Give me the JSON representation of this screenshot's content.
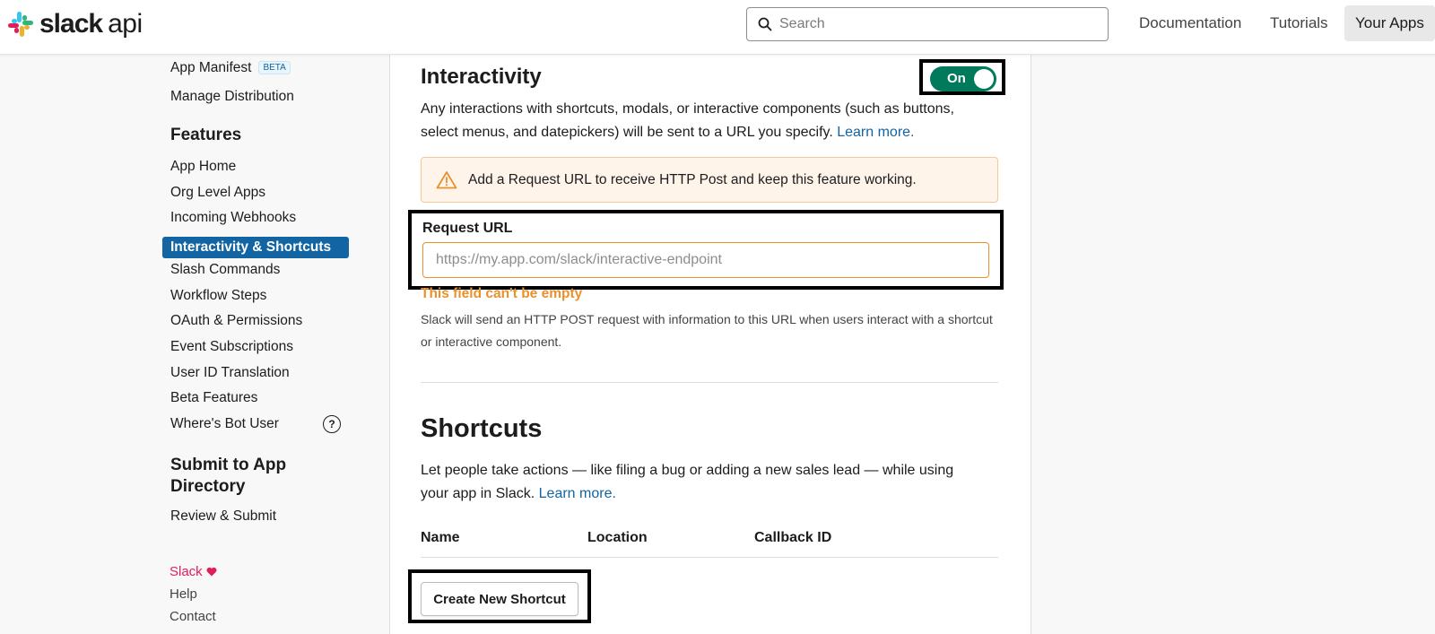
{
  "header": {
    "logo_word": "slack",
    "logo_suffix": "api",
    "search_placeholder": "Search",
    "nav": {
      "documentation": "Documentation",
      "tutorials": "Tutorials",
      "your_apps": "Your Apps"
    }
  },
  "sidebar": {
    "top_items": [
      {
        "label": "App Manifest",
        "badge": "BETA"
      },
      {
        "label": "Manage Distribution"
      }
    ],
    "features_heading": "Features",
    "features": [
      "App Home",
      "Org Level Apps",
      "Incoming Webhooks",
      "Interactivity & Shortcuts",
      "Slash Commands",
      "Workflow Steps",
      "OAuth & Permissions",
      "Event Subscriptions",
      "User ID Translation",
      "Beta Features",
      "Where's Bot User"
    ],
    "active_feature": "Interactivity & Shortcuts",
    "help_glyph": "?",
    "submit_heading_line1": "Submit to App",
    "submit_heading_line2": "Directory",
    "review_submit": "Review & Submit",
    "footer": {
      "slack": "Slack",
      "help": "Help",
      "contact": "Contact"
    }
  },
  "interactivity": {
    "title": "Interactivity",
    "toggle_label": "On",
    "toggle_state": true,
    "description": "Any interactions with shortcuts, modals, or interactive components (such as buttons, select menus, and datepickers) will be sent to a URL you specify.",
    "learn_more": "Learn more.",
    "warning_text": "Add a Request URL to receive HTTP Post and keep this feature working.",
    "request_url_label": "Request URL",
    "request_url_value": "",
    "request_url_placeholder": "https://my.app.com/slack/interactive-endpoint",
    "error_text": "This field can't be empty",
    "hint_text": "Slack will send an HTTP POST request with information to this URL when users interact with a shortcut or interactive component."
  },
  "shortcuts": {
    "title": "Shortcuts",
    "description": "Let people take actions — like filing a bug or adding a new sales lead — while using your app in Slack.",
    "learn_more": "Learn more.",
    "columns": [
      "Name",
      "Location",
      "Callback ID"
    ],
    "create_button": "Create New Shortcut"
  },
  "colors": {
    "active_nav": "#1264a3",
    "toggle_on": "#007a5a",
    "warning": "#e8912d",
    "link": "#1264a3"
  }
}
